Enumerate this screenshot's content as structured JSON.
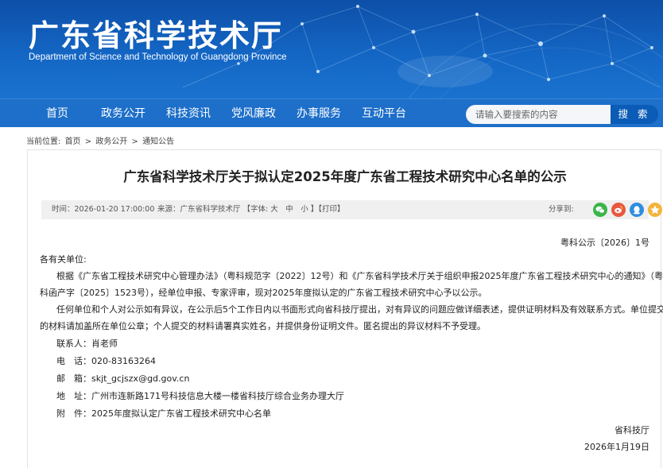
{
  "header": {
    "title_cn": "广东省科学技术厅",
    "title_en": "Department of Science and Technology of Guangdong Province"
  },
  "nav": {
    "items": [
      "首页",
      "政务公开",
      "科技资讯",
      "党风廉政",
      "办事服务",
      "互动平台"
    ],
    "search_placeholder": "请输入要搜索的内容",
    "search_button": "搜 索"
  },
  "breadcrumb": {
    "label": "当前位置:",
    "items": [
      "首页",
      "政务公开",
      "通知公告"
    ],
    "separator": ">"
  },
  "article": {
    "title": "广东省科学技术厅关于拟认定2025年度广东省工程技术研究中心名单的公示",
    "time": "时间：2026-01-20 17:00:00",
    "source": "来源：广东省科学技术厅 【字体: 大　中　小 】【打印】",
    "share_label": "分享到:",
    "share_icons": [
      "wechat-icon",
      "weibo-icon",
      "qq-icon",
      "qzone-icon"
    ],
    "doc_number": "粤科公示〔2026〕1号",
    "salutation": "各有关单位:",
    "para1_line1": "根据《广东省工程技术研究中心管理办法》（粤科规范字〔2022〕12号）和《广东省科学技术厅关于组织申报2025年度广东省工程技术研究中心的通知》（粤",
    "para1_line2": "科函产字〔2025〕1523号），经单位申报、专家评审，现对2025年度拟认定的广东省工程技术研究中心予以公示。",
    "para2_line1": "任何单位和个人对公示如有异议，在公示后5个工作日内以书面形式向省科技厅提出，对有异议的问题应做详细表述，提供证明材料及有效联系方式。单位提交",
    "para2_line2": "的材料请加盖所在单位公章；个人提交的材料请署真实姓名，并提供身份证明文件。匿名提出的异议材料不予受理。",
    "contact_person": "联系人：肖老师",
    "phone": "电　话：020-83163264",
    "email": "邮　箱：skjt_gcjszx@gd.gov.cn",
    "address": "地　址：广州市连新路171号科技信息大楼一楼省科技厅综合业务办理大厅",
    "attachment": "附　件：2025年度拟认定广东省工程技术研究中心名单",
    "signature": "省科技厅",
    "date": "2026年1月19日"
  },
  "colors": {
    "banner": "#1466c4",
    "nav": "#1d6fc9",
    "search_button": "#0b5cb6",
    "wechat": "#3bb54a",
    "weibo": "#e8573f",
    "qq": "#2d8ee0",
    "qzone": "#f2b43a"
  }
}
